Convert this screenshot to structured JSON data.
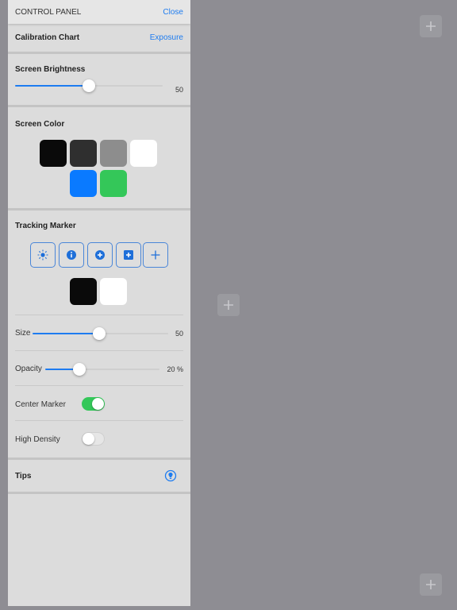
{
  "header": {
    "title": "CONTROL PANEL",
    "close_label": "Close"
  },
  "calibration": {
    "label": "Calibration Chart",
    "action_label": "Exposure"
  },
  "brightness": {
    "title": "Screen Brightness",
    "value": "50",
    "level": 0.5
  },
  "screen_color": {
    "title": "Screen Color",
    "swatches": [
      "#0a0a0a",
      "#2f2f2f",
      "#8d8d8d",
      "#ffffff",
      "#0a7aff",
      "#34c759"
    ]
  },
  "tracking": {
    "title": "Tracking Marker",
    "markers": [
      "sun-icon",
      "info-circle-icon",
      "plus-circle-icon",
      "plus-square-icon",
      "plus-icon"
    ],
    "marker_colors": [
      "#0a0a0a",
      "#ffffff"
    ],
    "size": {
      "label": "Size",
      "value": "50",
      "level": 0.5
    },
    "opacity": {
      "label": "Opacity",
      "value": "20 %",
      "level": 0.2
    },
    "center_marker": {
      "label": "Center Marker",
      "on": true
    },
    "high_density": {
      "label": "High Density",
      "on": false
    }
  },
  "tips": {
    "label": "Tips",
    "icon": "lightbulb-icon"
  },
  "colors": {
    "accent": "#1e7cf0",
    "toggle_on": "#34c759"
  }
}
